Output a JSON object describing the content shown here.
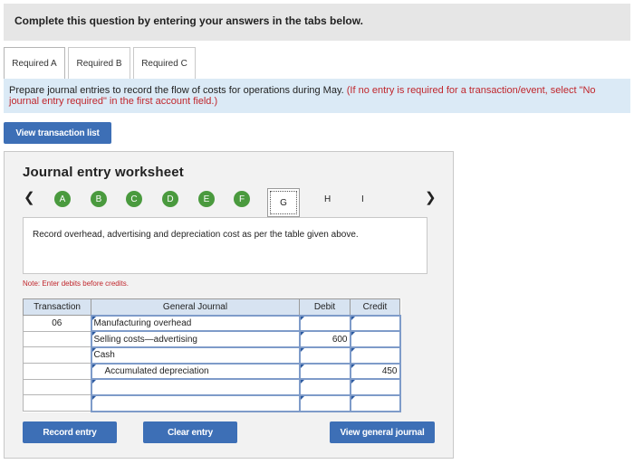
{
  "header": {
    "title": "Complete this question by entering your answers in the tabs below."
  },
  "tabs": [
    {
      "label": "Required A",
      "active": true
    },
    {
      "label": "Required B",
      "active": false
    },
    {
      "label": "Required C",
      "active": false
    }
  ],
  "instructions": {
    "text": "Prepare journal entries to record the flow of costs for operations during May.",
    "note": "(If no entry is required for a transaction/event, select \"No journal entry required\" in the first account field.)"
  },
  "buttons": {
    "view_transaction_list": "View transaction list",
    "record_entry": "Record entry",
    "clear_entry": "Clear entry",
    "view_general_journal": "View general journal"
  },
  "worksheet": {
    "title": "Journal entry worksheet",
    "prev_icon": "chevron-left-icon",
    "next_icon": "chevron-right-icon",
    "completed_steps": [
      "A",
      "B",
      "C",
      "D",
      "E",
      "F"
    ],
    "current_step": "G",
    "pending_steps": [
      "H",
      "I"
    ],
    "description": "Record overhead, advertising and depreciation cost as per the table given above.",
    "note": "Note: Enter debits before credits."
  },
  "journal": {
    "headers": {
      "transaction": "Transaction",
      "general_journal": "General Journal",
      "debit": "Debit",
      "credit": "Credit"
    },
    "rows": [
      {
        "transaction": "06",
        "account": "Manufacturing overhead",
        "debit": "",
        "credit": ""
      },
      {
        "transaction": "",
        "account": "Selling costs—advertising",
        "debit": "600",
        "credit": ""
      },
      {
        "transaction": "",
        "account": "Cash",
        "debit": "",
        "credit": ""
      },
      {
        "transaction": "",
        "account": "Accumulated depreciation",
        "debit": "",
        "credit": "450"
      },
      {
        "transaction": "",
        "account": "",
        "debit": "",
        "credit": ""
      },
      {
        "transaction": "",
        "account": "",
        "debit": "",
        "credit": ""
      }
    ]
  },
  "colors": {
    "accent_blue": "#3d6fb6",
    "completed_green": "#4a9a3e",
    "note_red": "#c0262c",
    "instruction_bg": "#dbeaf6"
  }
}
